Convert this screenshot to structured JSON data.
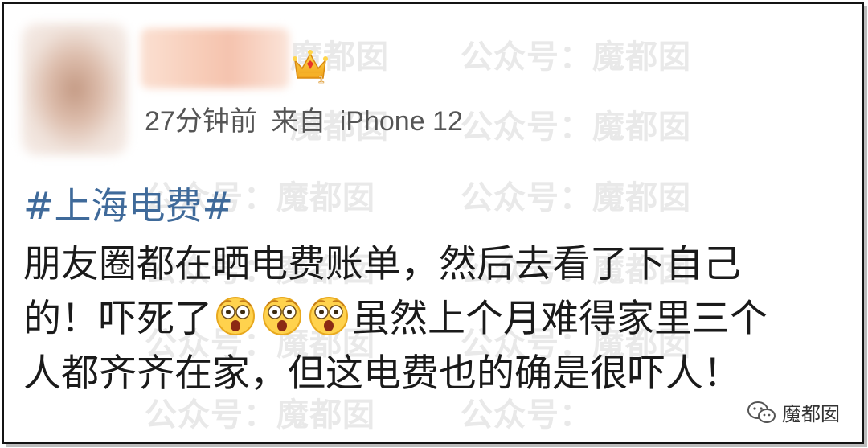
{
  "watermark": {
    "top_left": "魔都囡",
    "account": "公众号：魔都囡",
    "short": "公众号："
  },
  "meta": {
    "time": "27分钟前",
    "source_prefix": "来自",
    "device": "iPhone 12"
  },
  "badge": {
    "icon": "crown-icon",
    "level": "1"
  },
  "post": {
    "topic": "#上海电费#",
    "line1": "朋友圈都在晒电费账单，然后去看了下自己",
    "line2_start": "的！吓死了",
    "line2_end": "虽然上个月难得家里三个",
    "line3": "人都齐齐在家，但这电费也的确是很吓人！",
    "emoji_icon": "shocked-face-icon"
  },
  "signature": {
    "text": "魔都囡",
    "icon": "wechat-icon"
  },
  "colors": {
    "topic": "#3f6a9a",
    "text": "#1a1a1a",
    "meta": "#555555",
    "watermark": "#e9e9e9"
  }
}
